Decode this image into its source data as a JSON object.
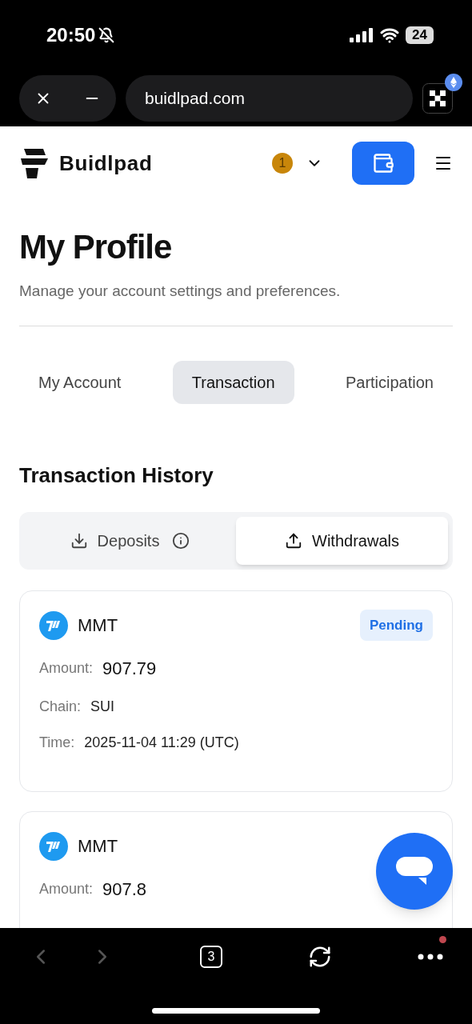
{
  "status_bar": {
    "time": "20:50",
    "silent": true,
    "battery": "24"
  },
  "browser": {
    "url": "buidlpad.com",
    "tab_count": "3",
    "menu_badge": true
  },
  "header": {
    "brand": "Buidlpad",
    "notification_count": "1"
  },
  "page": {
    "title": "My Profile",
    "subtitle": "Manage your account settings and preferences."
  },
  "tabs": [
    {
      "label": "My Account",
      "selected": false
    },
    {
      "label": "Transaction",
      "selected": true
    },
    {
      "label": "Participation",
      "selected": false
    }
  ],
  "section": {
    "title": "Transaction History"
  },
  "segments": [
    {
      "label": "Deposits",
      "kind": "download",
      "info": true,
      "selected": false
    },
    {
      "label": "Withdrawals",
      "kind": "upload",
      "info": false,
      "selected": true
    }
  ],
  "transactions": [
    {
      "token": "MMT",
      "status": "Pending",
      "fields": [
        {
          "label": "Amount:",
          "value": "907.79",
          "kind": "amount"
        },
        {
          "label": "Chain:",
          "value": "SUI",
          "kind": "plain"
        },
        {
          "label": "Time:",
          "value": "2025-11-04 11:29 (UTC)",
          "kind": "plain"
        }
      ]
    },
    {
      "token": "MMT",
      "fields": [
        {
          "label": "Amount:",
          "value": "907.8",
          "kind": "amount"
        }
      ]
    }
  ]
}
